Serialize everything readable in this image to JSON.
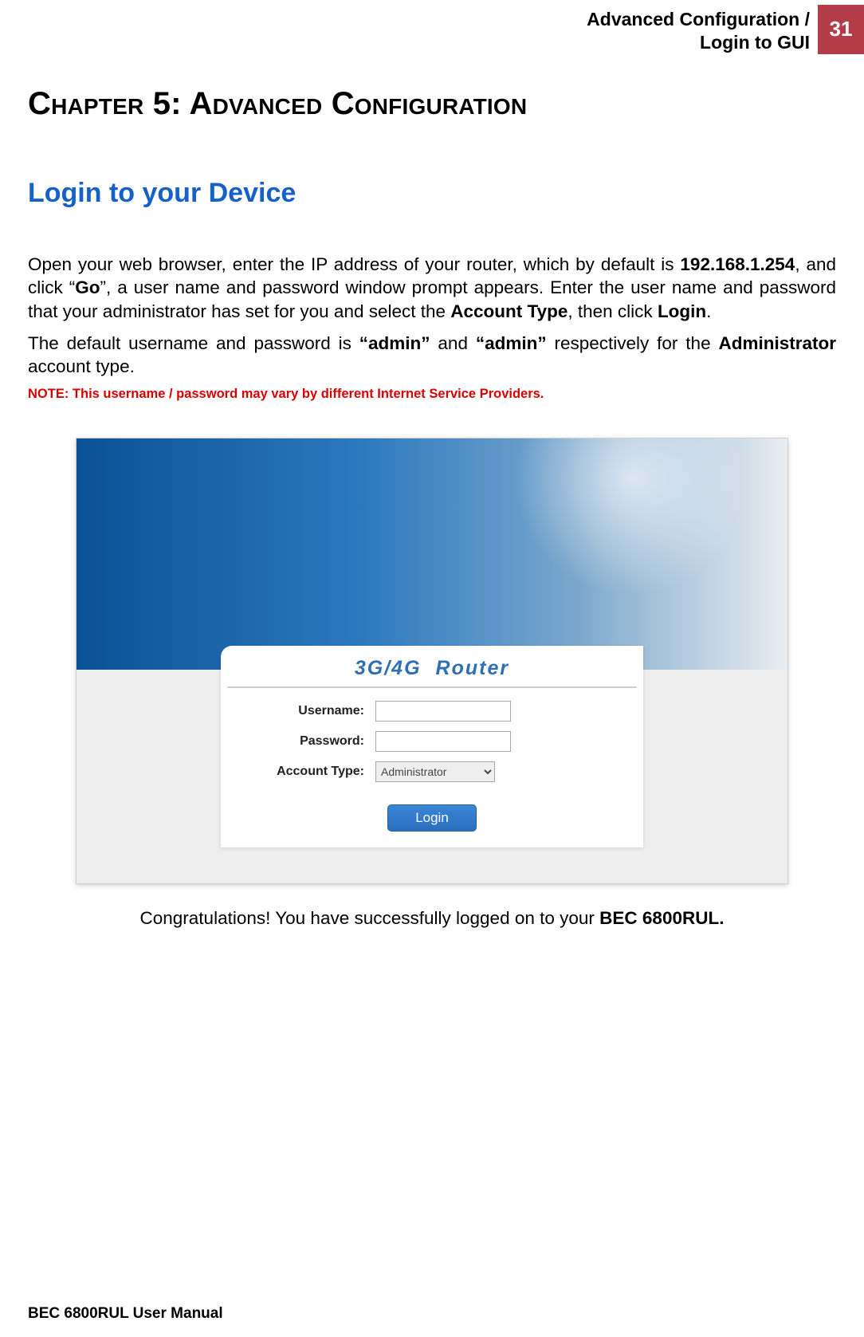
{
  "header": {
    "title_line1": "Advanced Configuration /",
    "title_line2": "Login to GUI",
    "page_number": "31"
  },
  "chapter": {
    "title": "Chapter 5: Advanced Configuration"
  },
  "section": {
    "heading": "Login to your Device"
  },
  "paragraphs": {
    "p1_a": "Open your web browser, enter the IP address of your router, which by default is ",
    "p1_ip": "192.168.1.254",
    "p1_b": ", and click “",
    "p1_go": "Go",
    "p1_c": "”, a user name and password window prompt appears. Enter the user name and password that your administrator has set for you and select the ",
    "p1_acct": "Account Type",
    "p1_d": ", then click ",
    "p1_login": "Login",
    "p1_e": ".",
    "p2_a": "The default username and password is ",
    "p2_admin1": "“admin”",
    "p2_b": " and ",
    "p2_admin2": "“admin”",
    "p2_c": " respectively for the ",
    "p2_admin_word": "Administrator",
    "p2_d": " account type."
  },
  "note": "NOTE: This username / password may vary by different Internet Service Providers.",
  "login_screenshot": {
    "panel_title_a": "3G/4G",
    "panel_title_b": "Router",
    "username_label": "Username:",
    "password_label": "Password:",
    "account_type_label": "Account Type:",
    "account_type_value": "Administrator",
    "login_button": "Login"
  },
  "congrats": {
    "a": "Congratulations! You have successfully logged on to your ",
    "b": "BEC 6800RUL."
  },
  "footer": "BEC 6800RUL User Manual"
}
